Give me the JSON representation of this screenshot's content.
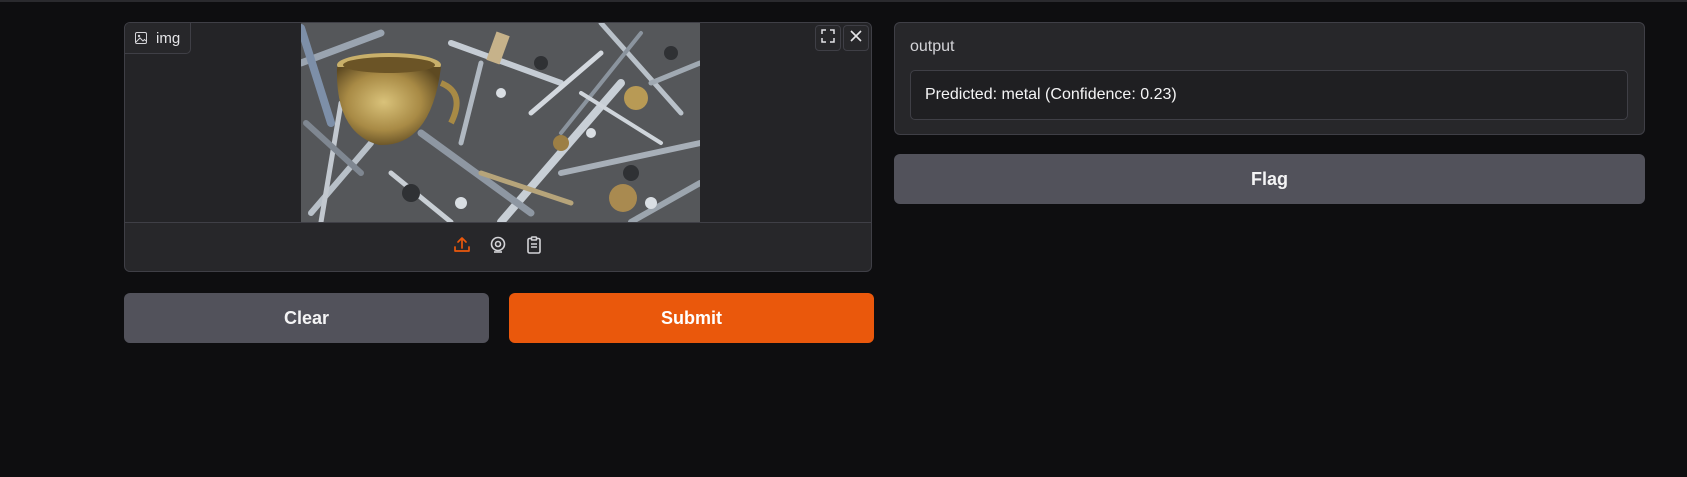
{
  "image_input": {
    "label": "img",
    "icons": {
      "label_icon": "image-icon",
      "fullscreen": "fullscreen-icon",
      "close": "close-icon"
    },
    "sources": [
      {
        "name": "upload",
        "icon": "upload-icon",
        "active": true
      },
      {
        "name": "webcam",
        "icon": "webcam-icon",
        "active": false
      },
      {
        "name": "clipboard",
        "icon": "clipboard-icon",
        "active": false
      }
    ]
  },
  "buttons": {
    "clear": "Clear",
    "submit": "Submit",
    "flag": "Flag"
  },
  "output": {
    "label": "output",
    "value": "Predicted: metal (Confidence: 0.23)"
  },
  "colors": {
    "background": "#0e0e10",
    "panel": "#27272a",
    "border": "#3f3f46",
    "primary": "#ea580c",
    "secondary": "#52525b"
  }
}
